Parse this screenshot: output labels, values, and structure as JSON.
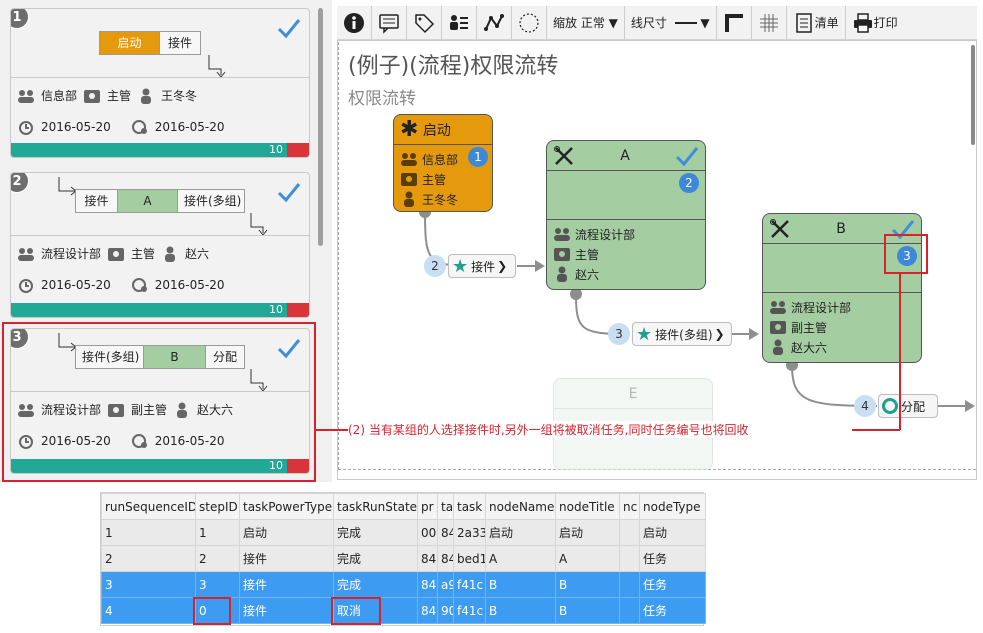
{
  "colors": {
    "accent_orange": "#e59a0e",
    "node_green": "#a4cda2",
    "progress_teal": "#22a897",
    "alert_red": "#d9232c",
    "select_blue": "#3d9bf2"
  },
  "cards": [
    {
      "num": "1",
      "flow": [
        "启动",
        "接件"
      ],
      "dept": "信息部",
      "role": "主管",
      "user": "王冬冬",
      "date1": "2016-05-20",
      "date2": "2016-05-20",
      "count": "10"
    },
    {
      "num": "2",
      "flow": [
        "接件",
        "A",
        "接件(多组)"
      ],
      "dept": "流程设计部",
      "role": "主管",
      "user": "赵六",
      "date1": "2016-05-20",
      "date2": "2016-05-20",
      "count": "10"
    },
    {
      "num": "3",
      "flow": [
        "接件(多组)",
        "B",
        "分配"
      ],
      "dept": "流程设计部",
      "role": "副主管",
      "user": "赵大六",
      "date1": "2016-05-20",
      "date2": "2016-05-20",
      "count": "10"
    }
  ],
  "toolbar": {
    "zoom_label": "缩放",
    "zoom_value": "正常",
    "line_label": "线尺寸",
    "list_label": "清单",
    "print_label": "打印"
  },
  "canvas": {
    "title": "(例子)(流程)权限流转",
    "subtitle": "权限流转"
  },
  "nodes": {
    "start": {
      "title": "启动",
      "dept": "信息部",
      "role": "主管",
      "user": "王冬冬",
      "badge": "1"
    },
    "a": {
      "title": "A",
      "dept": "流程设计部",
      "role": "主管",
      "user": "赵六",
      "badge": "2"
    },
    "b": {
      "title": "B",
      "dept": "流程设计部",
      "role": "副主管",
      "user": "赵大六",
      "badge": "3"
    },
    "e": {
      "title": "E"
    }
  },
  "edges": [
    {
      "num": "2",
      "label": "接件"
    },
    {
      "num": "3",
      "label": "接件(多组)"
    },
    {
      "num": "4",
      "label": "分配"
    }
  ],
  "annotation": "(2) 当有某组的人选择接件时,另外一组将被取消任务,同时任务编号也将回收",
  "table": {
    "headers": [
      "runSequenceID",
      "stepID",
      "taskPowerType",
      "taskRunState",
      "pr",
      "ta",
      "task",
      "nodeName",
      "nodeTitle",
      "nc",
      "nodeType"
    ],
    "rows": [
      [
        "1",
        "1",
        "启动",
        "完成",
        "00",
        "84",
        "2a33",
        "启动",
        "启动",
        "",
        "启动"
      ],
      [
        "2",
        "2",
        "接件",
        "完成",
        "84",
        "84",
        "bed1",
        "A",
        "A",
        "",
        "任务"
      ],
      [
        "3",
        "3",
        "接件",
        "完成",
        "84",
        "a9",
        "f41c",
        "B",
        "B",
        "",
        "任务"
      ],
      [
        "4",
        "0",
        "接件",
        "取消",
        "84",
        "90",
        "f41c",
        "B",
        "B",
        "",
        "任务"
      ]
    ]
  }
}
